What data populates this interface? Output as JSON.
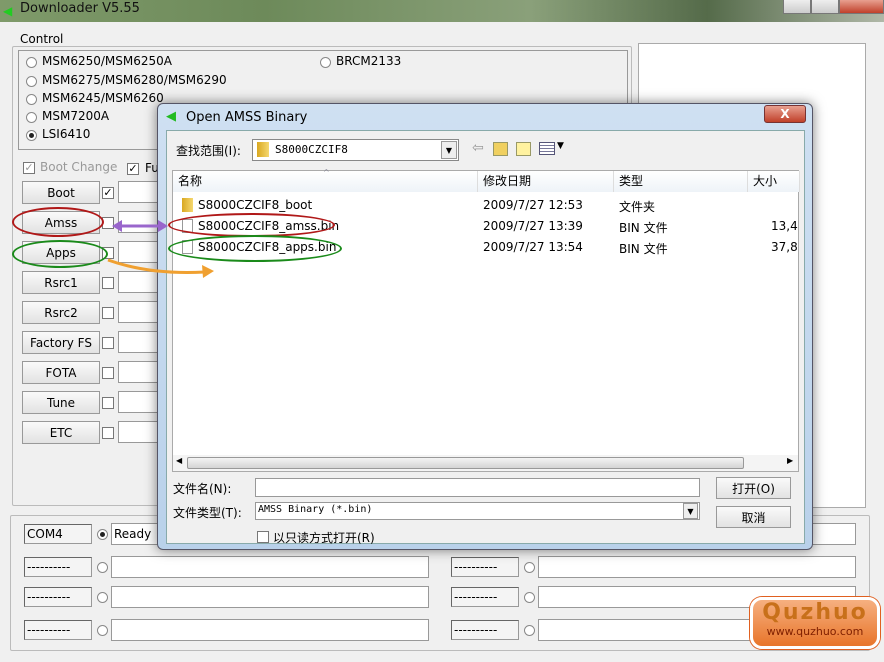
{
  "app": {
    "title": "Downloader V5.55"
  },
  "control": {
    "label": "Control",
    "chips": [
      {
        "label": "MSM6250/MSM6250A",
        "selected": false
      },
      {
        "label": "MSM6275/MSM6280/MSM6290",
        "selected": false
      },
      {
        "label": "MSM6245/MSM6260",
        "selected": false
      },
      {
        "label": "MSM7200A",
        "selected": false
      },
      {
        "label": "LSI6410",
        "selected": true
      },
      {
        "label": "BRCM2133",
        "selected": false
      }
    ],
    "boot_change": "Boot Change",
    "fu_label": "Fu",
    "buttons": [
      {
        "label": "Boot",
        "checked": true
      },
      {
        "label": "Amss",
        "checked": false
      },
      {
        "label": "Apps",
        "checked": false
      },
      {
        "label": "Rsrc1",
        "checked": false
      },
      {
        "label": "Rsrc2",
        "checked": false
      },
      {
        "label": "Factory FS",
        "checked": false
      },
      {
        "label": "FOTA",
        "checked": false
      },
      {
        "label": "Tune",
        "checked": false
      },
      {
        "label": "ETC",
        "checked": false
      }
    ]
  },
  "ports": {
    "left": [
      {
        "port": "COM4",
        "status": "Ready",
        "selected": true
      },
      {
        "port": "----------",
        "status": ""
      },
      {
        "port": "----------",
        "status": ""
      },
      {
        "port": "----------",
        "status": ""
      }
    ],
    "right": [
      {
        "port": "----------",
        "status": ""
      },
      {
        "port": "----------",
        "status": ""
      },
      {
        "port": "----------",
        "status": ""
      },
      {
        "port": "----------",
        "status": ""
      }
    ]
  },
  "dialog": {
    "title": "Open AMSS Binary",
    "close": "X",
    "look_in_label": "查找范围(I):",
    "look_in_value": "S8000CZCIF8",
    "columns": [
      "名称",
      "修改日期",
      "类型",
      "大小"
    ],
    "files": [
      {
        "name": "S8000CZCIF8_boot",
        "date": "2009/7/27 12:53",
        "type": "文件夹",
        "size": "",
        "icon": "folder-icon"
      },
      {
        "name": "S8000CZCIF8_amss.bin",
        "date": "2009/7/27 13:39",
        "type": "BIN 文件",
        "size": "13,4",
        "icon": "file-icon"
      },
      {
        "name": "S8000CZCIF8_apps.bin",
        "date": "2009/7/27 13:54",
        "type": "BIN 文件",
        "size": "37,8",
        "icon": "file-icon"
      }
    ],
    "filename_label": "文件名(N):",
    "filename_value": "",
    "filetype_label": "文件类型(T):",
    "filetype_value": "AMSS Binary (*.bin)",
    "readonly_label": "以只读方式打开(R)",
    "open": "打开(O)",
    "cancel": "取消"
  },
  "annotation_colors": {
    "red": "#b01818",
    "green": "#1a8a1a",
    "purple": "#9966cc",
    "orange": "#f0a030"
  },
  "watermark": {
    "brand": "Quzhuo",
    "url": "www.quzhuo.com"
  }
}
